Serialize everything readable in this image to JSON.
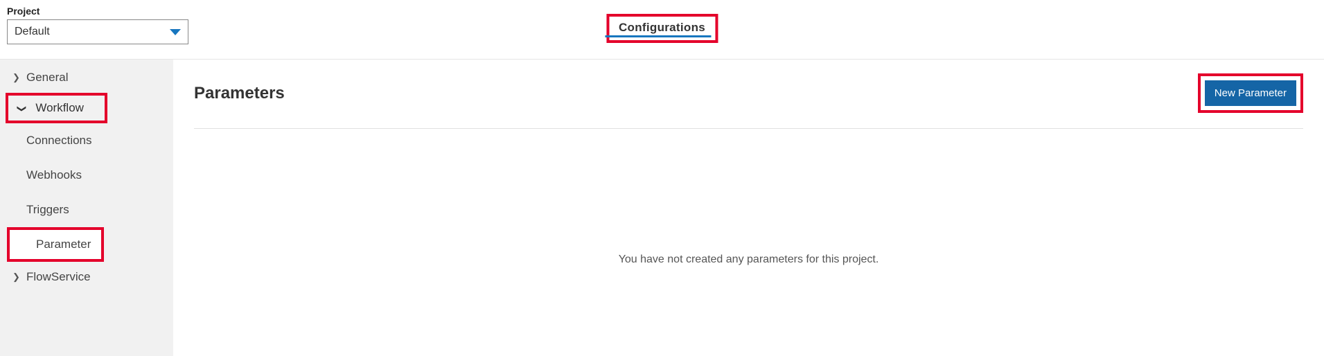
{
  "project": {
    "label": "Project",
    "selected": "Default"
  },
  "tabs": {
    "configurations": "Configurations"
  },
  "sidebar": {
    "general": "General",
    "workflow": "Workflow",
    "workflow_children": {
      "connections": "Connections",
      "webhooks": "Webhooks",
      "triggers": "Triggers",
      "parameter": "Parameter"
    },
    "flowservice": "FlowService"
  },
  "main": {
    "title": "Parameters",
    "new_param_btn": "New Parameter",
    "empty_message": "You have not created any parameters for this project."
  }
}
